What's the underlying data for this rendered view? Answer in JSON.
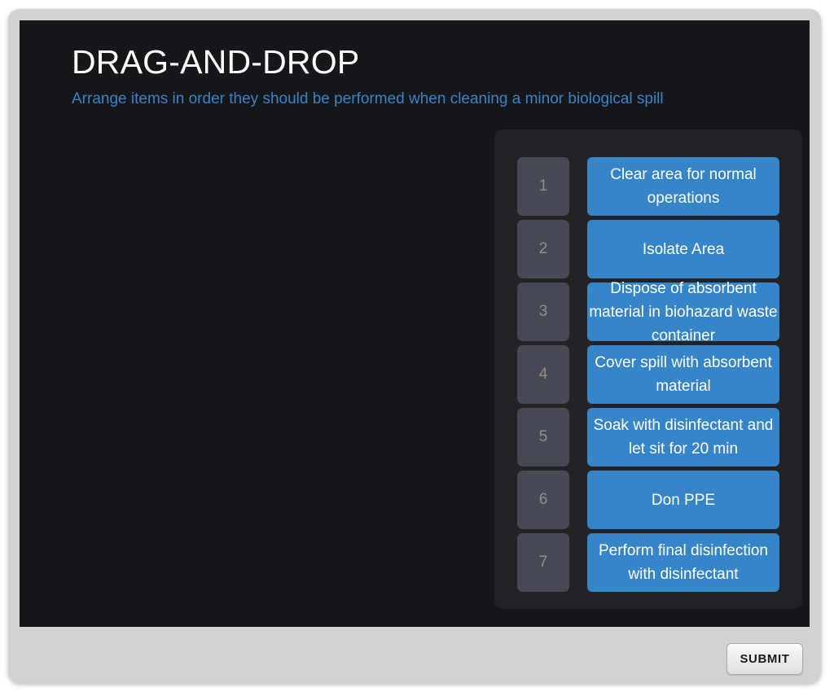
{
  "activity": {
    "title": "DRAG-AND-DROP",
    "subtitle": "Arrange items in order they should be performed when cleaning a minor biological spill"
  },
  "colors": {
    "frame": "#d2d2d2",
    "stage": "#15171a",
    "bank_panel": "#232327",
    "card_blue": "#3585c8",
    "slot_gray": "#474a54",
    "slot_number": "#8d8d8d",
    "subtitle_blue": "#3b82c4",
    "title_white": "#ffffff"
  },
  "bank": {
    "items": [
      {
        "number": "1",
        "label": "Clear area for normal operations",
        "lines": 2
      },
      {
        "number": "2",
        "label": "Isolate Area",
        "lines": 1
      },
      {
        "number": "3",
        "label": "Dispose of absorbent material in biohazard waste container",
        "lines": 3
      },
      {
        "number": "4",
        "label": "Cover spill with absorbent material",
        "lines": 2
      },
      {
        "number": "5",
        "label": "Soak with disinfectant and let sit for 20 min",
        "lines": 2
      },
      {
        "number": "6",
        "label": "Don PPE",
        "lines": 1
      },
      {
        "number": "7",
        "label": "Perform final disinfection with disinfectant",
        "lines": 3
      }
    ]
  },
  "footer": {
    "submit_label": "SUBMIT"
  }
}
